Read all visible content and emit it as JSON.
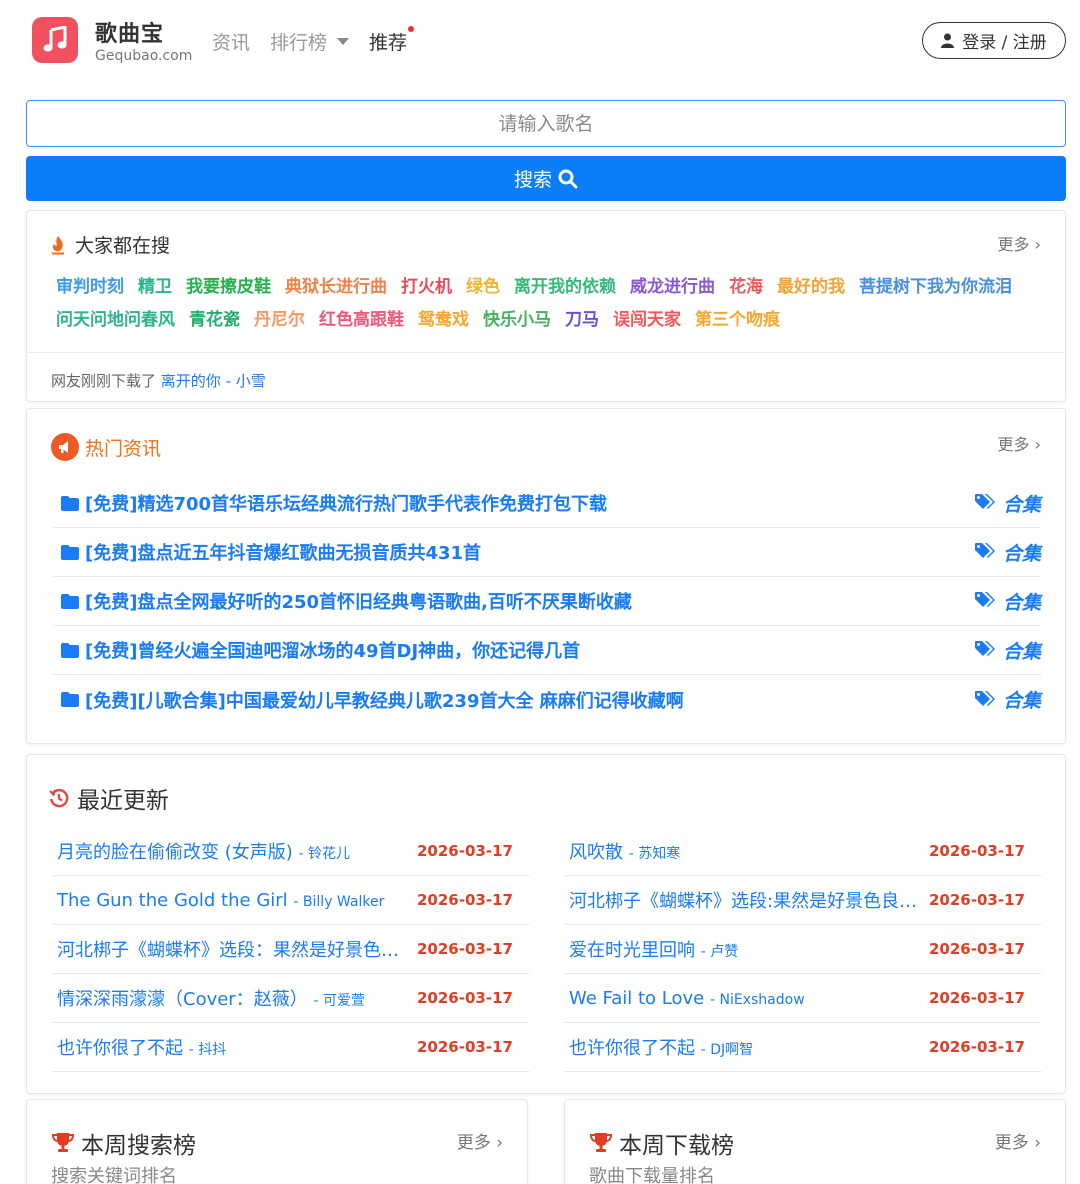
{
  "header": {
    "brand_name": "歌曲宝",
    "brand_domain": "Gequbao.com",
    "nav": {
      "news": "资讯",
      "rank": "排行榜",
      "recommend": "推荐"
    },
    "login_label": "登录 / 注册"
  },
  "search": {
    "placeholder": "请输入歌名",
    "button_label": "搜索"
  },
  "hot_search": {
    "title": "大家都在搜",
    "more_label": "更多",
    "tags": [
      {
        "text": "审判时刻",
        "color": "#3e9be9"
      },
      {
        "text": "精卫",
        "color": "#2bb58f"
      },
      {
        "text": "我要擦皮鞋",
        "color": "#26b24f"
      },
      {
        "text": "典狱长进行曲",
        "color": "#f0824a"
      },
      {
        "text": "打火机",
        "color": "#ee4b5a"
      },
      {
        "text": "绿色",
        "color": "#f4b332"
      },
      {
        "text": "离开我的依赖",
        "color": "#37b97a"
      },
      {
        "text": "威龙进行曲",
        "color": "#8a57d6"
      },
      {
        "text": "花海",
        "color": "#ee5a5a"
      },
      {
        "text": "最好的我",
        "color": "#f4a433"
      },
      {
        "text": "菩提树下我为你流泪",
        "color": "#4a90e2"
      },
      {
        "text": "问天问地问春风",
        "color": "#2fb38f"
      },
      {
        "text": "青花瓷",
        "color": "#24ad6c"
      },
      {
        "text": "丹尼尔",
        "color": "#f49a62"
      },
      {
        "text": "红色高跟鞋",
        "color": "#f0587a"
      },
      {
        "text": "鸳鸯戏",
        "color": "#f5a732"
      },
      {
        "text": "快乐小马",
        "color": "#46b25c"
      },
      {
        "text": "刀马",
        "color": "#6a4de0"
      },
      {
        "text": "误闯天家",
        "color": "#f15a5a"
      },
      {
        "text": "第三个吻痕",
        "color": "#f5a732"
      }
    ],
    "recent_download_prefix": "网友刚刚下载了",
    "recent_download_song": "离开的你 - 小雪"
  },
  "hot_news": {
    "title": "热门资讯",
    "more_label": "更多",
    "items": [
      {
        "title": "[免费]精选700首华语乐坛经典流行热门歌手代表作免费打包下载",
        "tag": "合集"
      },
      {
        "title": "[免费]盘点近五年抖音爆红歌曲无损音质共431首",
        "tag": "合集"
      },
      {
        "title": "[免费]盘点全网最好听的250首怀旧经典粤语歌曲,百听不厌果断收藏",
        "tag": "合集"
      },
      {
        "title": "[免费]曾经火遍全国迪吧溜冰场的49首DJ神曲，你还记得几首",
        "tag": "合集"
      },
      {
        "title": "[免费][儿歌合集]中国最爱幼儿早教经典儿歌239首大全 麻麻们记得收藏啊",
        "tag": "合集"
      }
    ]
  },
  "latest": {
    "title": "最近更新",
    "left": [
      {
        "song": "月亮的脸在偷偷改变 (女声版)",
        "artist": "铃花儿",
        "date": "2026-03-17"
      },
      {
        "song": "The Gun the Gold the Girl",
        "artist": "Billy Walker",
        "date": "2026-03-17"
      },
      {
        "song": "河北梆子《蝴蝶杯》选段：果然是好景色良辰美景",
        "artist": "",
        "date": "2026-03-17"
      },
      {
        "song": "情深深雨濛濛（Cover：赵薇）",
        "artist": "可爱萱",
        "date": "2026-03-17"
      },
      {
        "song": "也许你很了不起",
        "artist": "抖抖",
        "date": "2026-03-17"
      }
    ],
    "right": [
      {
        "song": "风吹散",
        "artist": "苏知寒",
        "date": "2026-03-17"
      },
      {
        "song": "河北梆子《蝴蝶杯》选段:果然是好景色良辰美景",
        "artist": "",
        "date": "2026-03-17"
      },
      {
        "song": "爱在时光里回响",
        "artist": "卢赞",
        "date": "2026-03-17"
      },
      {
        "song": "We Fail to Love",
        "artist": "NiExshadow",
        "date": "2026-03-17"
      },
      {
        "song": "也许你很了不起",
        "artist": "DJ啊智",
        "date": "2026-03-17"
      }
    ]
  },
  "weekly_search": {
    "title": "本周搜索榜",
    "subtitle": "搜索关键词排名",
    "more_label": "更多"
  },
  "weekly_download": {
    "title": "本周下载榜",
    "subtitle": "歌曲下载量排名",
    "more_label": "更多"
  }
}
